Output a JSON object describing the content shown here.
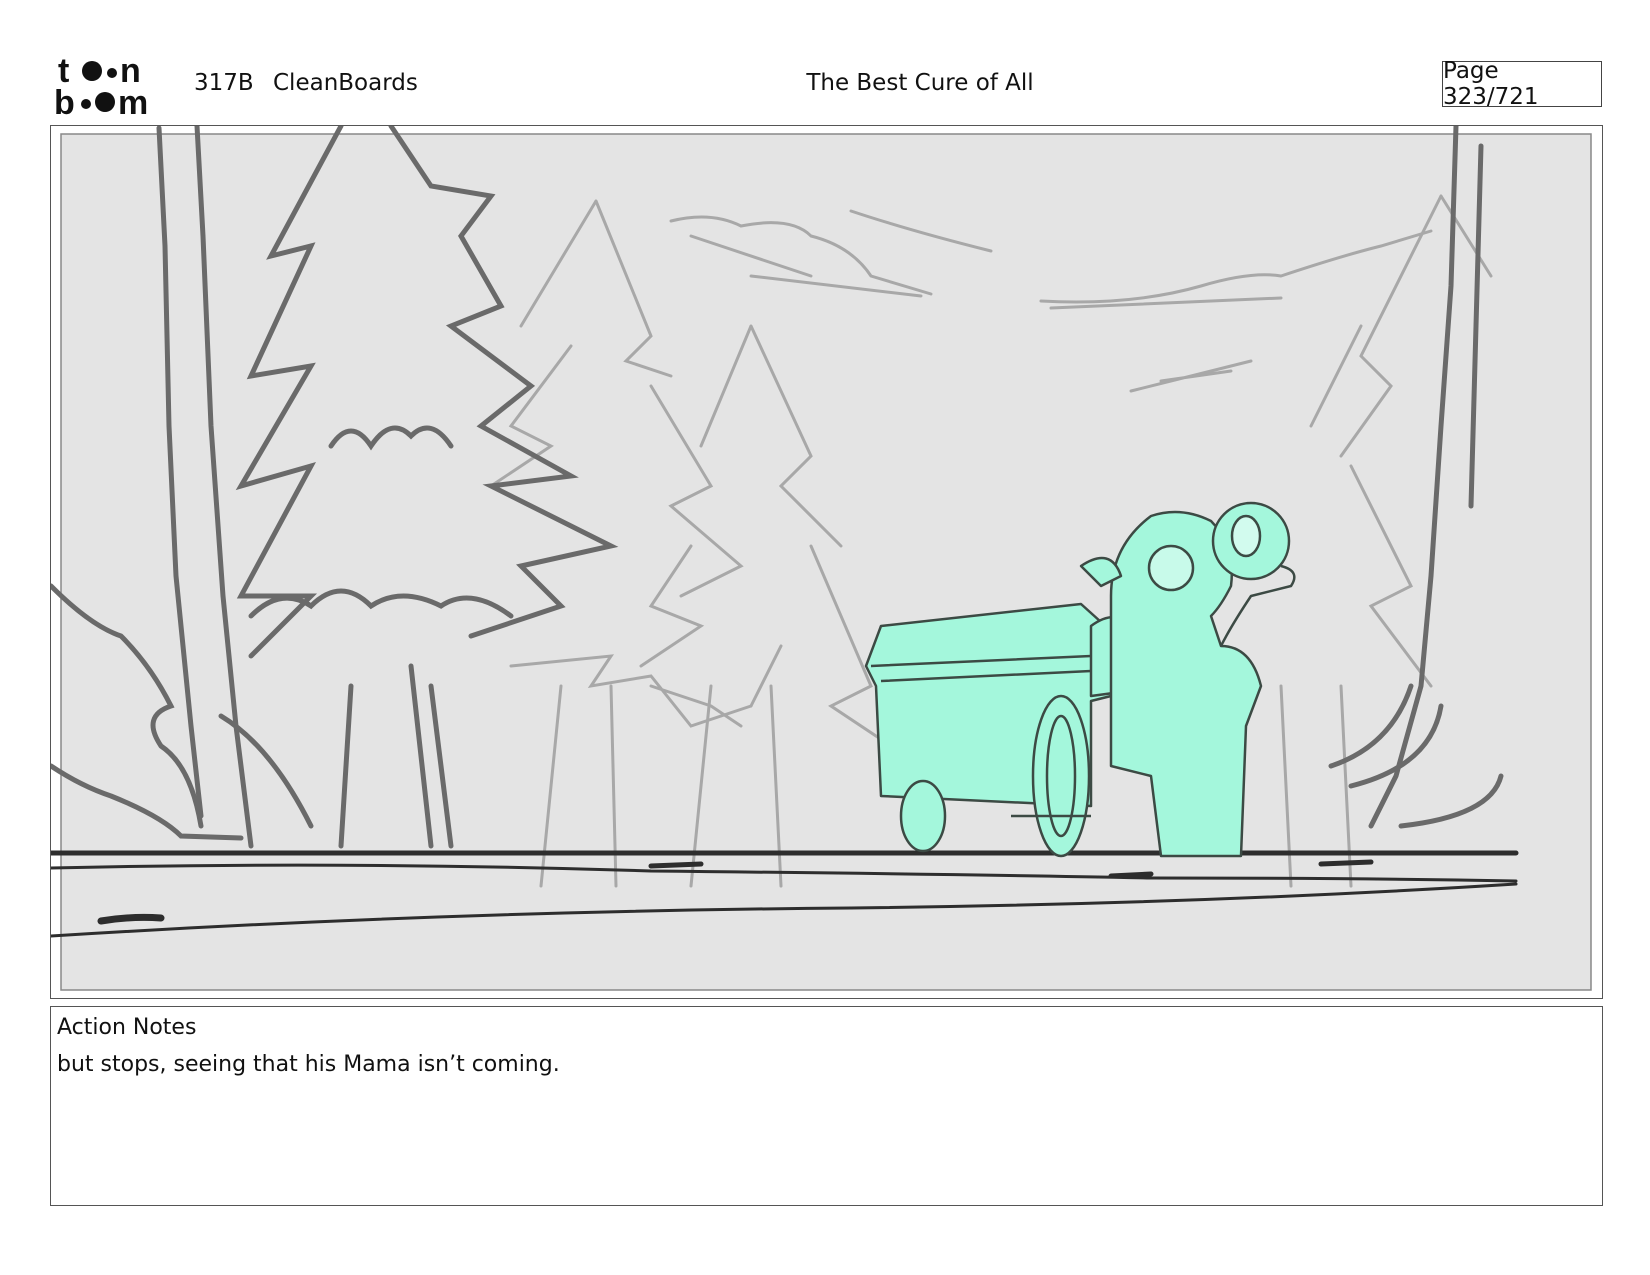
{
  "header": {
    "logo_text": "toon boom",
    "episode_code": "317B",
    "episode_name": "CleanBoards",
    "title": "The Best Cure of All",
    "page_label": "Page 323/721"
  },
  "notes": {
    "label": "Action Notes",
    "text": "but stops, seeing that his Mama isn’t coming."
  },
  "colors": {
    "character_fill": "#a4f7dc",
    "panel_background": "#e4e4e4"
  }
}
